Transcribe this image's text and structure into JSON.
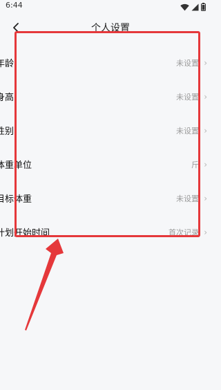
{
  "status_bar": {
    "time": "6:44"
  },
  "header": {
    "title": "个人设置"
  },
  "settings": [
    {
      "label": "年龄",
      "value": "未设置"
    },
    {
      "label": "身高",
      "value": "未设置"
    },
    {
      "label": "性别",
      "value": "未设置"
    },
    {
      "label": "体重单位",
      "value": "斤"
    },
    {
      "label": "目标体重",
      "value": "未设置"
    },
    {
      "label": "计划开始时间",
      "value": "首次记录"
    }
  ],
  "annotation": {
    "color": "#e5383b"
  },
  "icons": {
    "back": "chevron-left-icon",
    "row_chevron": "chevron-right-icon",
    "wifi": "wifi-icon",
    "signal": "cellular-signal-icon",
    "battery": "battery-icon"
  }
}
